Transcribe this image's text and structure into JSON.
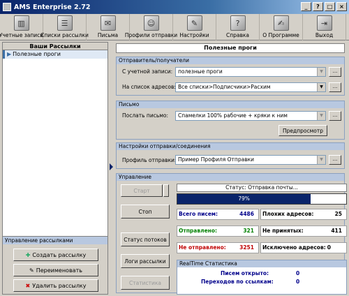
{
  "window": {
    "title": "AMS Enterprise 2.72",
    "buttons": [
      "_",
      "?",
      "□",
      "×"
    ]
  },
  "toolbar": {
    "items": [
      {
        "label": "Учетные записи",
        "icon": "accounts-icon"
      },
      {
        "label": "Списки рассылки",
        "icon": "lists-icon"
      },
      {
        "label": "Письма",
        "icon": "letters-icon"
      },
      {
        "label": "Профили отправки",
        "icon": "profiles-icon"
      },
      {
        "label": "Настройки",
        "icon": "settings-icon"
      },
      {
        "label": "Справка",
        "icon": "help-icon"
      },
      {
        "label": "О Программе",
        "icon": "about-icon"
      },
      {
        "label": "Выход",
        "icon": "exit-icon"
      }
    ]
  },
  "left": {
    "header": "Ваши Рассылки",
    "item": "Полезные проги",
    "mgmt_header": "Управление рассылками",
    "create": "Создать рассылку",
    "rename": "Переименовать",
    "delete": "Удалить рассылку"
  },
  "right": {
    "title": "Полезные проги",
    "sender": {
      "header": "Отправитель/получатели",
      "account_label": "С учетной записи:",
      "account_value": "полезные проги",
      "list_label": "На список адресов:",
      "list_value": "Все списки>Подписчики>Расхим"
    },
    "letter": {
      "header": "Письмо",
      "send_label": "Послать письмо:",
      "send_value": "Спамелки 100% рабочие + кряки к ним",
      "preview": "Предпросмотр"
    },
    "settings": {
      "header": "Настройки отправки/соединения",
      "profile_label": "Профиль отправки:",
      "profile_value": "Пример Профиля Отправки"
    },
    "control": {
      "header": "Управление",
      "start": "Старт",
      "stop": "Стоп",
      "threads": "Статус потоков",
      "logs": "Логи рассылки",
      "stats": "Статистика",
      "status": "Статус: Отправка почты...",
      "progress_label": "79%",
      "progress_value": 0.79,
      "total_label": "Всего писем:",
      "total_value": "4486",
      "bad_label": "Плохих адресов:",
      "bad_value": "25",
      "sent_label": "Отправлено:",
      "sent_value": "321",
      "rejected_label": "Не принятых:",
      "rejected_value": "411",
      "unsent_label": "Не отправлено:",
      "unsent_value": "3251",
      "excluded_label": "Исключено адресов:",
      "excluded_value": "0"
    },
    "realtime": {
      "header": "RealTime Статистика",
      "opened_label": "Писем открыто:",
      "opened_value": "0",
      "clicks_label": "Переходов по ссылкам:",
      "clicks_value": "0"
    }
  },
  "colors": {
    "sent_green": "#008000",
    "unsent_red": "#c00000",
    "total_blue": "#00008b",
    "progress": "#0a246a"
  }
}
